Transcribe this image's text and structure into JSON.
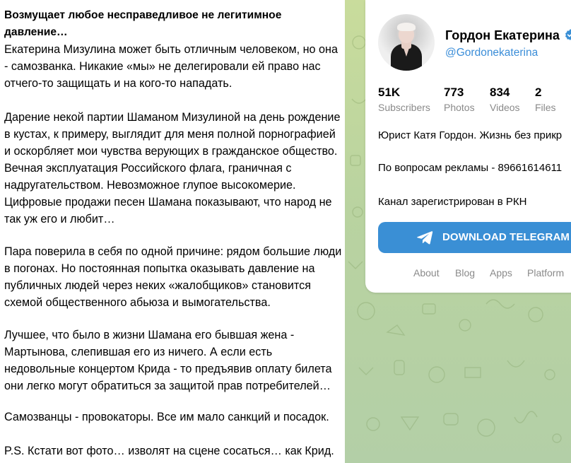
{
  "post": {
    "heading": "Возмущает любое несправедливое не легитимное давление…",
    "lines": [
      "Екатерина Мизулина может быть отличным человеком, но она",
      "- самозванка. Никакие «мы» не делегировали ей право нас",
      "отчего-то защищать и на кого-то нападать.",
      "Дарение некой партии Шаманом Мизулиной на день рождение",
      "в кустах, к примеру, выглядит для меня полной порнографией",
      "и оскорбляет мои чувства верующих в гражданское общество.",
      "Вечная эксплуатация Российского флага, граничная с",
      "надругательством. Невозможное глупое высокомерие.",
      "Цифровые продажи песен Шамана показывают, что народ не",
      "так уж его и любит…",
      "Пара поверила в себя по одной причине: рядом большие люди",
      "в погонах. Но постоянная попытка оказывать давление на",
      "публичных людей через неких «жалобщиков» становится",
      "схемой общественного абьюза и вымогательства.",
      "Лучшее, что было в жизни Шамана его бывшая жена -",
      "Мартынова, слепившая его из ничего. А если есть",
      "недовольные концертом Крида - то предъявив оплату билета",
      "они легко могут обратиться за защитой прав потребителей…",
      "Самозванцы - провокаторы. Все им мало санкций и посадок.",
      "P.S. Кстати вот фото… изволят на сцене сосаться… как Крид."
    ]
  },
  "channel": {
    "name": "Гордон Екатерина",
    "handle": "@Gordonekaterina",
    "stats": [
      {
        "value": "51K",
        "label": "Subscribers"
      },
      {
        "value": "773",
        "label": "Photos"
      },
      {
        "value": "834",
        "label": "Videos"
      },
      {
        "value": "2",
        "label": "Files"
      }
    ],
    "description": "Юрист Катя Гордон. Жизнь без прикр",
    "ads": "По вопросам рекламы - 89661614611",
    "registered": "Канал зарегистрирован в РКН",
    "download_label": "DOWNLOAD TELEGRAM",
    "footer_links": [
      "About",
      "Blog",
      "Apps",
      "Platform"
    ]
  },
  "colors": {
    "accent": "#3a8fd5",
    "handle": "#3a8dd8",
    "muted": "#8a8a8a",
    "pattern_bg": "#c0d7a1"
  },
  "icons": [
    "verified-badge-icon",
    "paper-plane-icon"
  ]
}
